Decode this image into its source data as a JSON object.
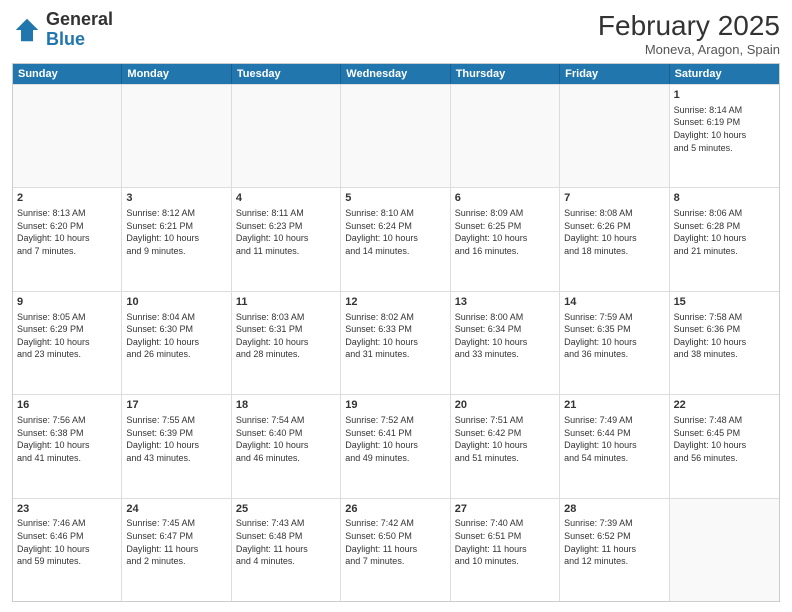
{
  "header": {
    "logo_general": "General",
    "logo_blue": "Blue",
    "month_title": "February 2025",
    "subtitle": "Moneva, Aragon, Spain"
  },
  "weekdays": [
    "Sunday",
    "Monday",
    "Tuesday",
    "Wednesday",
    "Thursday",
    "Friday",
    "Saturday"
  ],
  "rows": [
    [
      {
        "day": "",
        "empty": true,
        "info": ""
      },
      {
        "day": "",
        "empty": true,
        "info": ""
      },
      {
        "day": "",
        "empty": true,
        "info": ""
      },
      {
        "day": "",
        "empty": true,
        "info": ""
      },
      {
        "day": "",
        "empty": true,
        "info": ""
      },
      {
        "day": "",
        "empty": true,
        "info": ""
      },
      {
        "day": "1",
        "empty": false,
        "info": "Sunrise: 8:14 AM\nSunset: 6:19 PM\nDaylight: 10 hours\nand 5 minutes."
      }
    ],
    [
      {
        "day": "2",
        "empty": false,
        "info": "Sunrise: 8:13 AM\nSunset: 6:20 PM\nDaylight: 10 hours\nand 7 minutes."
      },
      {
        "day": "3",
        "empty": false,
        "info": "Sunrise: 8:12 AM\nSunset: 6:21 PM\nDaylight: 10 hours\nand 9 minutes."
      },
      {
        "day": "4",
        "empty": false,
        "info": "Sunrise: 8:11 AM\nSunset: 6:23 PM\nDaylight: 10 hours\nand 11 minutes."
      },
      {
        "day": "5",
        "empty": false,
        "info": "Sunrise: 8:10 AM\nSunset: 6:24 PM\nDaylight: 10 hours\nand 14 minutes."
      },
      {
        "day": "6",
        "empty": false,
        "info": "Sunrise: 8:09 AM\nSunset: 6:25 PM\nDaylight: 10 hours\nand 16 minutes."
      },
      {
        "day": "7",
        "empty": false,
        "info": "Sunrise: 8:08 AM\nSunset: 6:26 PM\nDaylight: 10 hours\nand 18 minutes."
      },
      {
        "day": "8",
        "empty": false,
        "info": "Sunrise: 8:06 AM\nSunset: 6:28 PM\nDaylight: 10 hours\nand 21 minutes."
      }
    ],
    [
      {
        "day": "9",
        "empty": false,
        "info": "Sunrise: 8:05 AM\nSunset: 6:29 PM\nDaylight: 10 hours\nand 23 minutes."
      },
      {
        "day": "10",
        "empty": false,
        "info": "Sunrise: 8:04 AM\nSunset: 6:30 PM\nDaylight: 10 hours\nand 26 minutes."
      },
      {
        "day": "11",
        "empty": false,
        "info": "Sunrise: 8:03 AM\nSunset: 6:31 PM\nDaylight: 10 hours\nand 28 minutes."
      },
      {
        "day": "12",
        "empty": false,
        "info": "Sunrise: 8:02 AM\nSunset: 6:33 PM\nDaylight: 10 hours\nand 31 minutes."
      },
      {
        "day": "13",
        "empty": false,
        "info": "Sunrise: 8:00 AM\nSunset: 6:34 PM\nDaylight: 10 hours\nand 33 minutes."
      },
      {
        "day": "14",
        "empty": false,
        "info": "Sunrise: 7:59 AM\nSunset: 6:35 PM\nDaylight: 10 hours\nand 36 minutes."
      },
      {
        "day": "15",
        "empty": false,
        "info": "Sunrise: 7:58 AM\nSunset: 6:36 PM\nDaylight: 10 hours\nand 38 minutes."
      }
    ],
    [
      {
        "day": "16",
        "empty": false,
        "info": "Sunrise: 7:56 AM\nSunset: 6:38 PM\nDaylight: 10 hours\nand 41 minutes."
      },
      {
        "day": "17",
        "empty": false,
        "info": "Sunrise: 7:55 AM\nSunset: 6:39 PM\nDaylight: 10 hours\nand 43 minutes."
      },
      {
        "day": "18",
        "empty": false,
        "info": "Sunrise: 7:54 AM\nSunset: 6:40 PM\nDaylight: 10 hours\nand 46 minutes."
      },
      {
        "day": "19",
        "empty": false,
        "info": "Sunrise: 7:52 AM\nSunset: 6:41 PM\nDaylight: 10 hours\nand 49 minutes."
      },
      {
        "day": "20",
        "empty": false,
        "info": "Sunrise: 7:51 AM\nSunset: 6:42 PM\nDaylight: 10 hours\nand 51 minutes."
      },
      {
        "day": "21",
        "empty": false,
        "info": "Sunrise: 7:49 AM\nSunset: 6:44 PM\nDaylight: 10 hours\nand 54 minutes."
      },
      {
        "day": "22",
        "empty": false,
        "info": "Sunrise: 7:48 AM\nSunset: 6:45 PM\nDaylight: 10 hours\nand 56 minutes."
      }
    ],
    [
      {
        "day": "23",
        "empty": false,
        "info": "Sunrise: 7:46 AM\nSunset: 6:46 PM\nDaylight: 10 hours\nand 59 minutes."
      },
      {
        "day": "24",
        "empty": false,
        "info": "Sunrise: 7:45 AM\nSunset: 6:47 PM\nDaylight: 11 hours\nand 2 minutes."
      },
      {
        "day": "25",
        "empty": false,
        "info": "Sunrise: 7:43 AM\nSunset: 6:48 PM\nDaylight: 11 hours\nand 4 minutes."
      },
      {
        "day": "26",
        "empty": false,
        "info": "Sunrise: 7:42 AM\nSunset: 6:50 PM\nDaylight: 11 hours\nand 7 minutes."
      },
      {
        "day": "27",
        "empty": false,
        "info": "Sunrise: 7:40 AM\nSunset: 6:51 PM\nDaylight: 11 hours\nand 10 minutes."
      },
      {
        "day": "28",
        "empty": false,
        "info": "Sunrise: 7:39 AM\nSunset: 6:52 PM\nDaylight: 11 hours\nand 12 minutes."
      },
      {
        "day": "",
        "empty": true,
        "info": ""
      }
    ]
  ]
}
